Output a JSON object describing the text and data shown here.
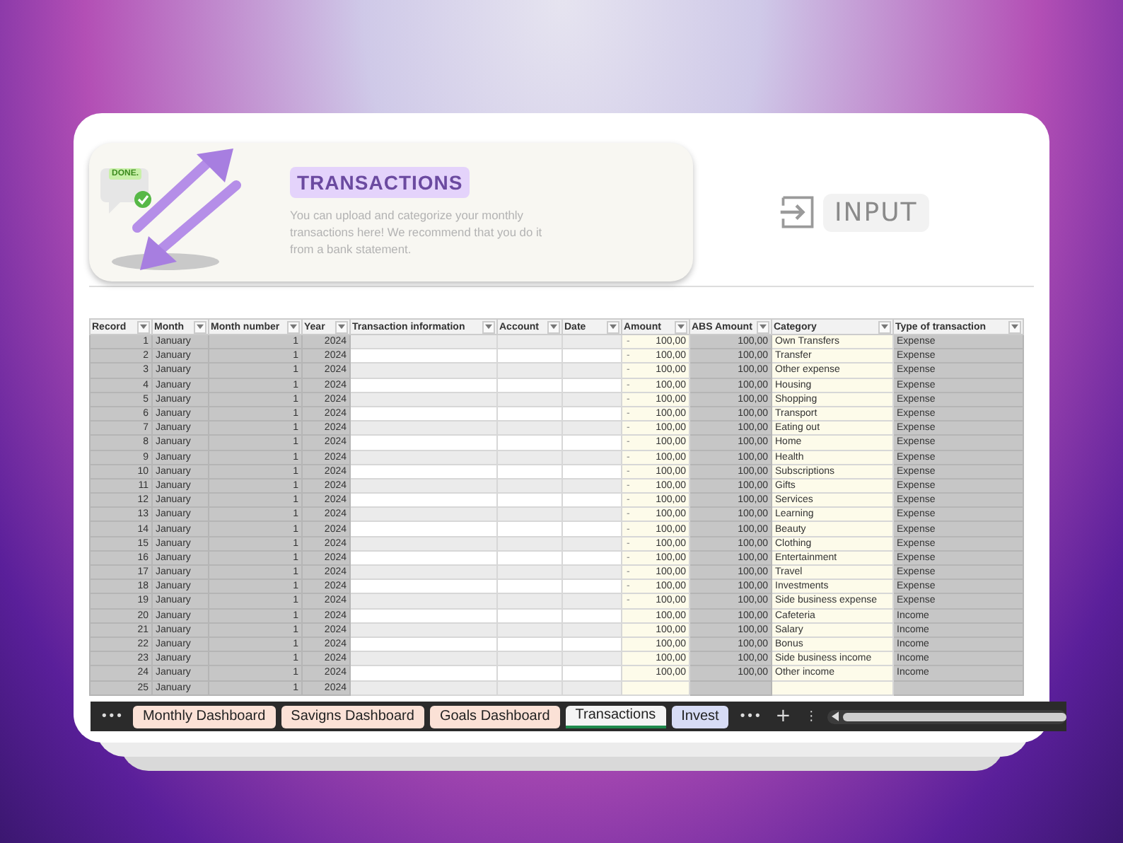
{
  "header": {
    "title": "TRANSACTIONS",
    "description": "You can upload and categorize your monthly transactions here! We recommend that you do it from a bank statement.",
    "badge": "DONE.",
    "input_button": "INPUT"
  },
  "table": {
    "columns": [
      "Record",
      "Month",
      "Month number",
      "Year",
      "Transaction  information",
      "Account",
      "Date",
      "Amount",
      "ABS Amount",
      "Category",
      "Type of transaction"
    ],
    "rows": [
      {
        "record": "1",
        "month": "January",
        "month_number": "1",
        "year": "2024",
        "amount_sign": "-",
        "amount": "100,00",
        "abs_amount": "100,00",
        "category": "Own Transfers",
        "type": "Expense"
      },
      {
        "record": "2",
        "month": "January",
        "month_number": "1",
        "year": "2024",
        "amount_sign": "-",
        "amount": "100,00",
        "abs_amount": "100,00",
        "category": "Transfer",
        "type": "Expense"
      },
      {
        "record": "3",
        "month": "January",
        "month_number": "1",
        "year": "2024",
        "amount_sign": "-",
        "amount": "100,00",
        "abs_amount": "100,00",
        "category": "Other expense",
        "type": "Expense"
      },
      {
        "record": "4",
        "month": "January",
        "month_number": "1",
        "year": "2024",
        "amount_sign": "-",
        "amount": "100,00",
        "abs_amount": "100,00",
        "category": "Housing",
        "type": "Expense"
      },
      {
        "record": "5",
        "month": "January",
        "month_number": "1",
        "year": "2024",
        "amount_sign": "-",
        "amount": "100,00",
        "abs_amount": "100,00",
        "category": "Shopping",
        "type": "Expense"
      },
      {
        "record": "6",
        "month": "January",
        "month_number": "1",
        "year": "2024",
        "amount_sign": "-",
        "amount": "100,00",
        "abs_amount": "100,00",
        "category": "Transport",
        "type": "Expense"
      },
      {
        "record": "7",
        "month": "January",
        "month_number": "1",
        "year": "2024",
        "amount_sign": "-",
        "amount": "100,00",
        "abs_amount": "100,00",
        "category": "Eating out",
        "type": "Expense"
      },
      {
        "record": "8",
        "month": "January",
        "month_number": "1",
        "year": "2024",
        "amount_sign": "-",
        "amount": "100,00",
        "abs_amount": "100,00",
        "category": "Home",
        "type": "Expense"
      },
      {
        "record": "9",
        "month": "January",
        "month_number": "1",
        "year": "2024",
        "amount_sign": "-",
        "amount": "100,00",
        "abs_amount": "100,00",
        "category": "Health",
        "type": "Expense"
      },
      {
        "record": "10",
        "month": "January",
        "month_number": "1",
        "year": "2024",
        "amount_sign": "-",
        "amount": "100,00",
        "abs_amount": "100,00",
        "category": "Subscriptions",
        "type": "Expense"
      },
      {
        "record": "11",
        "month": "January",
        "month_number": "1",
        "year": "2024",
        "amount_sign": "-",
        "amount": "100,00",
        "abs_amount": "100,00",
        "category": "Gifts",
        "type": "Expense"
      },
      {
        "record": "12",
        "month": "January",
        "month_number": "1",
        "year": "2024",
        "amount_sign": "-",
        "amount": "100,00",
        "abs_amount": "100,00",
        "category": "Services",
        "type": "Expense"
      },
      {
        "record": "13",
        "month": "January",
        "month_number": "1",
        "year": "2024",
        "amount_sign": "-",
        "amount": "100,00",
        "abs_amount": "100,00",
        "category": "Learning",
        "type": "Expense"
      },
      {
        "record": "14",
        "month": "January",
        "month_number": "1",
        "year": "2024",
        "amount_sign": "-",
        "amount": "100,00",
        "abs_amount": "100,00",
        "category": "Beauty",
        "type": "Expense"
      },
      {
        "record": "15",
        "month": "January",
        "month_number": "1",
        "year": "2024",
        "amount_sign": "-",
        "amount": "100,00",
        "abs_amount": "100,00",
        "category": "Clothing",
        "type": "Expense"
      },
      {
        "record": "16",
        "month": "January",
        "month_number": "1",
        "year": "2024",
        "amount_sign": "-",
        "amount": "100,00",
        "abs_amount": "100,00",
        "category": "Entertainment",
        "type": "Expense"
      },
      {
        "record": "17",
        "month": "January",
        "month_number": "1",
        "year": "2024",
        "amount_sign": "-",
        "amount": "100,00",
        "abs_amount": "100,00",
        "category": "Travel",
        "type": "Expense"
      },
      {
        "record": "18",
        "month": "January",
        "month_number": "1",
        "year": "2024",
        "amount_sign": "-",
        "amount": "100,00",
        "abs_amount": "100,00",
        "category": "Investments",
        "type": "Expense"
      },
      {
        "record": "19",
        "month": "January",
        "month_number": "1",
        "year": "2024",
        "amount_sign": "-",
        "amount": "100,00",
        "abs_amount": "100,00",
        "category": "Side business expense",
        "type": "Expense"
      },
      {
        "record": "20",
        "month": "January",
        "month_number": "1",
        "year": "2024",
        "amount": "100,00",
        "abs_amount": "100,00",
        "category": "Cafeteria",
        "type": "Income"
      },
      {
        "record": "21",
        "month": "January",
        "month_number": "1",
        "year": "2024",
        "amount": "100,00",
        "abs_amount": "100,00",
        "category": "Salary",
        "type": "Income"
      },
      {
        "record": "22",
        "month": "January",
        "month_number": "1",
        "year": "2024",
        "amount": "100,00",
        "abs_amount": "100,00",
        "category": "Bonus",
        "type": "Income"
      },
      {
        "record": "23",
        "month": "January",
        "month_number": "1",
        "year": "2024",
        "amount": "100,00",
        "abs_amount": "100,00",
        "category": "Side business income",
        "type": "Income"
      },
      {
        "record": "24",
        "month": "January",
        "month_number": "1",
        "year": "2024",
        "amount": "100,00",
        "abs_amount": "100,00",
        "category": "Other income",
        "type": "Income"
      },
      {
        "record": "25",
        "month": "January",
        "month_number": "1",
        "year": "2024"
      }
    ]
  },
  "sheet_tabs": {
    "more_left": "•••",
    "tabs": [
      {
        "label": "Monthly Dashboard",
        "selected": false
      },
      {
        "label": "Savigns Dashboard",
        "selected": false
      },
      {
        "label": "Goals Dashboard",
        "selected": false
      },
      {
        "label": "Transactions",
        "selected": true
      },
      {
        "label": "Invest",
        "selected": false
      }
    ],
    "more_right": "•••",
    "add": "+",
    "options": "⋮"
  }
}
